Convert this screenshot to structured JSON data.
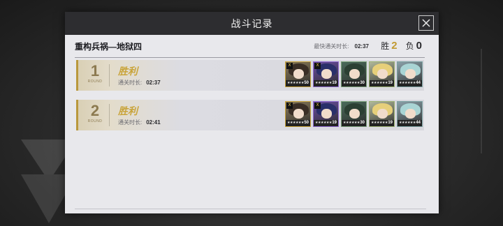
{
  "dialog": {
    "title": "战斗记录",
    "stage_name": "重构兵祸—地狱四",
    "best_time_label": "最快通关时长:",
    "best_time_value": "02:37",
    "win_label": "胜",
    "win_count": "2",
    "loss_label": "负",
    "loss_count": "0"
  },
  "records": [
    {
      "index": "1",
      "round_label": "ROUND",
      "result": "胜利",
      "time_label": "通关时长:",
      "time_value": "02:37",
      "team": [
        {
          "level": "50",
          "stars": "★★★★★★",
          "rank": "Ⅹ",
          "bg": "#8a7a5a",
          "hair": "#3a2e25",
          "frame": "#c9a43a"
        },
        {
          "level": "19",
          "stars": "★★★★★★",
          "rank": "Ⅹ",
          "bg": "#6a4fa0",
          "hair": "#2a2f6a",
          "frame": "#8f6ad0"
        },
        {
          "level": "30",
          "stars": "★★★★★★",
          "rank": "",
          "bg": "#4a6a5a",
          "hair": "#2b3f33",
          "frame": "#7aa07a"
        },
        {
          "level": "19",
          "stars": "★★★★★★",
          "rank": "",
          "bg": "#b0b89a",
          "hair": "#e6cf7a",
          "frame": "#9ab070"
        },
        {
          "level": "44",
          "stars": "★★★★★★",
          "rank": "",
          "bg": "#8aa0a8",
          "hair": "#a9d4d4",
          "frame": "#7aa0a0"
        }
      ]
    },
    {
      "index": "2",
      "round_label": "ROUND",
      "result": "胜利",
      "time_label": "通关时长:",
      "time_value": "02:41",
      "team": [
        {
          "level": "50",
          "stars": "★★★★★★",
          "rank": "Ⅹ",
          "bg": "#8a7a5a",
          "hair": "#3a2e25",
          "frame": "#c9a43a"
        },
        {
          "level": "19",
          "stars": "★★★★★★",
          "rank": "Ⅹ",
          "bg": "#6a4fa0",
          "hair": "#2a2f6a",
          "frame": "#8f6ad0"
        },
        {
          "level": "30",
          "stars": "★★★★★★",
          "rank": "",
          "bg": "#4a6a5a",
          "hair": "#2b3f33",
          "frame": "#7aa07a"
        },
        {
          "level": "19",
          "stars": "★★★★★★",
          "rank": "",
          "bg": "#b0b89a",
          "hair": "#e6cf7a",
          "frame": "#9ab070"
        },
        {
          "level": "44",
          "stars": "★★★★★★",
          "rank": "",
          "bg": "#8aa0a8",
          "hair": "#a9d4d4",
          "frame": "#7aa0a0"
        }
      ]
    }
  ]
}
